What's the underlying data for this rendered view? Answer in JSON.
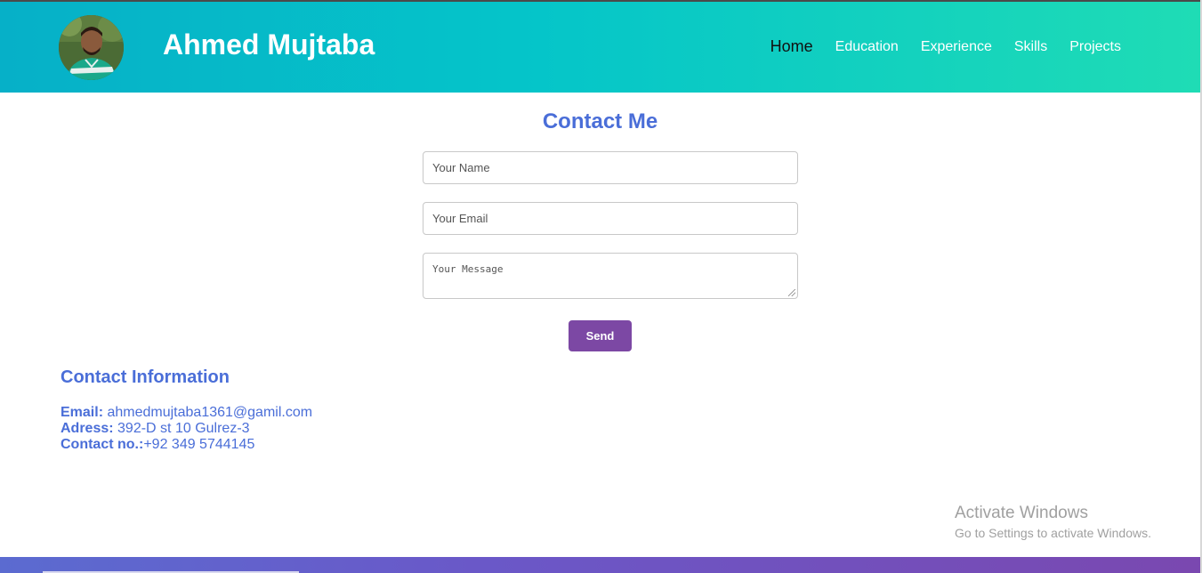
{
  "header": {
    "title": "Ahmed Mujtaba",
    "nav": [
      "Home",
      "Education",
      "Experience",
      "Skills",
      "Projects"
    ],
    "active_nav": "Home"
  },
  "contact": {
    "heading": "Contact Me",
    "name_placeholder": "Your Name",
    "email_placeholder": "Your Email",
    "message_placeholder": "Your Message",
    "send_label": "Send"
  },
  "contact_info": {
    "heading": "Contact Information",
    "email_label": "Email:",
    "email_value": "ahmedmujtaba1361@gamil.com",
    "address_label": "Adress:",
    "address_value": "392-D st 10 Gulrez-3",
    "phone_label": "Contact no.:",
    "phone_value": "+92 349 5744145"
  },
  "watermark": {
    "line1": "Activate Windows",
    "line2": "Go to Settings to activate Windows."
  },
  "colors": {
    "header_gradient_start": "#06b0c8",
    "header_gradient_end": "#1fdcb5",
    "accent_blue": "#4a6ed8",
    "send_purple": "#7c48a4"
  }
}
